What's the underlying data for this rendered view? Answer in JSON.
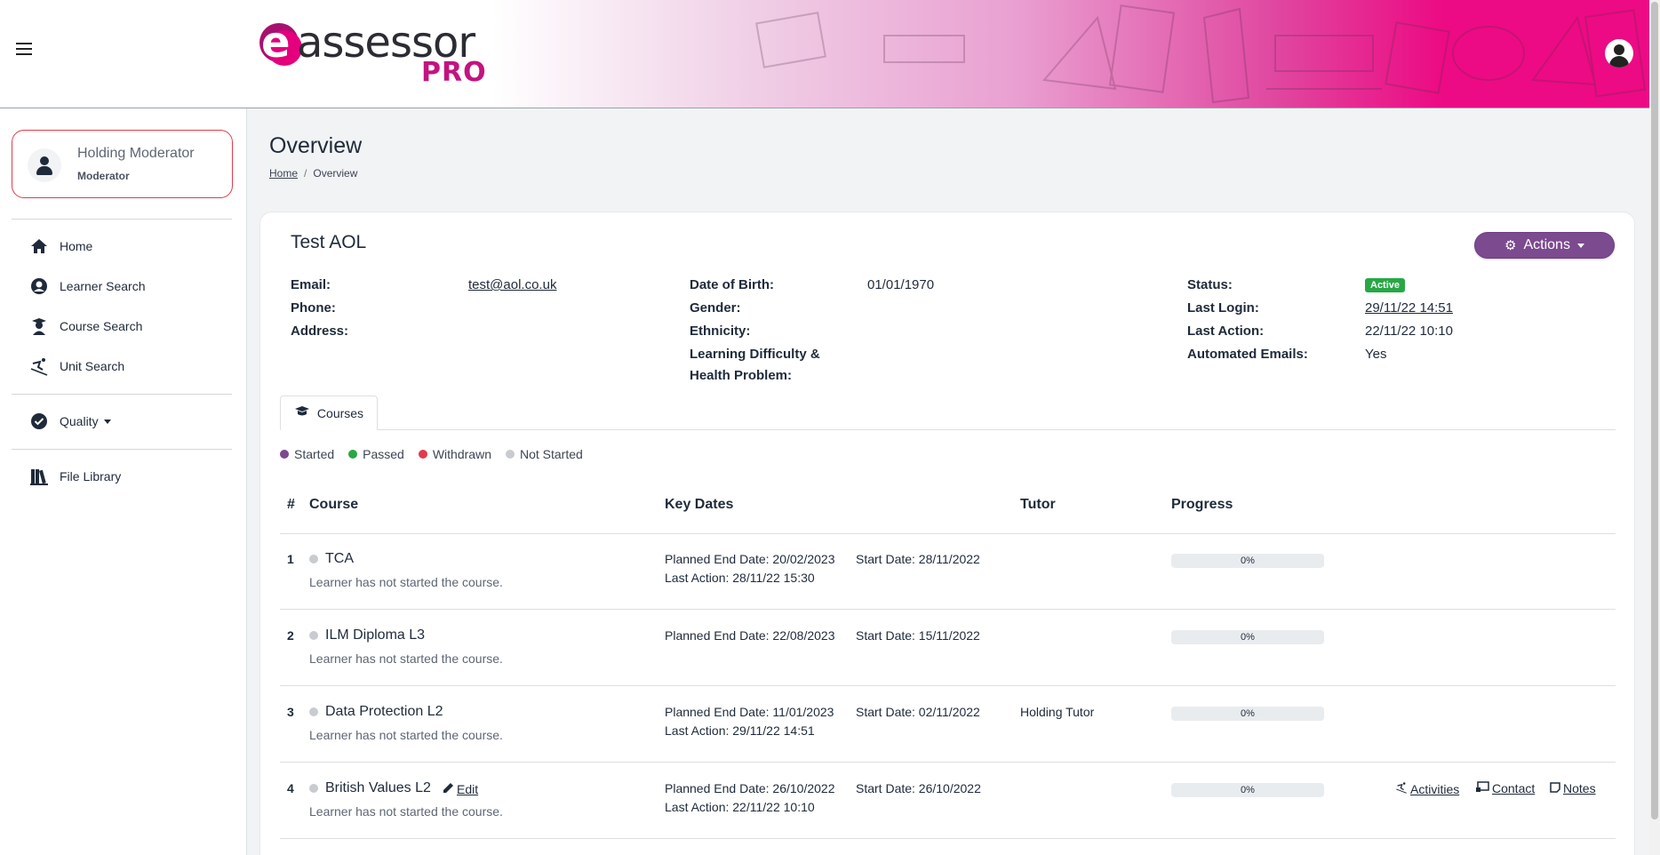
{
  "header": {
    "logo_letter": "e",
    "logo_word": "assessor",
    "logo_pro": "PRO"
  },
  "sidebar": {
    "profile": {
      "name": "Holding Moderator",
      "role": "Moderator"
    },
    "items": [
      {
        "label": "Home",
        "icon": "home-icon"
      },
      {
        "label": "Learner Search",
        "icon": "user-circle-icon"
      },
      {
        "label": "Course Search",
        "icon": "graduate-icon"
      },
      {
        "label": "Unit Search",
        "icon": "skiing-icon"
      },
      {
        "label": "Quality",
        "icon": "check-circle-icon"
      },
      {
        "label": "File Library",
        "icon": "books-icon"
      }
    ]
  },
  "page": {
    "title": "Overview",
    "breadcrumb": {
      "home": "Home",
      "sep": "/",
      "current": "Overview"
    }
  },
  "learner": {
    "name": "Test AOL",
    "actions_label": "Actions",
    "fields": {
      "email_label": "Email:",
      "email_value": "test@aol.co.uk",
      "phone_label": "Phone:",
      "address_label": "Address:",
      "dob_label": "Date of Birth:",
      "dob_value": "01/01/1970",
      "gender_label": "Gender:",
      "ethnicity_label": "Ethnicity:",
      "ldhp_label_1": "Learning Difficulty &",
      "ldhp_label_2": "Health Problem:",
      "status_label": "Status:",
      "status_value": "Active",
      "last_login_label": "Last Login:",
      "last_login_value": "29/11/22 14:51",
      "last_action_label": "Last Action:",
      "last_action_value": "22/11/22 10:10",
      "auto_emails_label": "Automated Emails:",
      "auto_emails_value": "Yes"
    }
  },
  "tabs": {
    "courses": "Courses"
  },
  "legend": [
    {
      "label": "Started",
      "color": "#7c4a8f"
    },
    {
      "label": "Passed",
      "color": "#27a844"
    },
    {
      "label": "Withdrawn",
      "color": "#e23c4a"
    },
    {
      "label": "Not Started",
      "color": "#c8ccd1"
    }
  ],
  "table": {
    "headers": {
      "num": "#",
      "course": "Course",
      "key_dates": "Key Dates",
      "tutor": "Tutor",
      "progress": "Progress"
    },
    "rows": [
      {
        "num": "1",
        "course": "TCA",
        "sub": "Learner has not started the course.",
        "planned": "Planned End Date: 20/02/2023",
        "last_action": "Last Action: 28/11/22 15:30",
        "start": "Start Date: 28/11/2022",
        "tutor": "",
        "progress": 0,
        "progress_label": "0%"
      },
      {
        "num": "2",
        "course": "ILM Diploma L3",
        "sub": "Learner has not started the course.",
        "planned": "Planned End Date: 22/08/2023",
        "last_action": "",
        "start": "Start Date: 15/11/2022",
        "tutor": "",
        "progress": 0,
        "progress_label": "0%"
      },
      {
        "num": "3",
        "course": "Data Protection L2",
        "sub": "Learner has not started the course.",
        "planned": "Planned End Date: 11/01/2023",
        "last_action": "Last Action: 29/11/22 14:51",
        "start": "Start Date: 02/11/2022",
        "tutor": "Holding Tutor",
        "progress": 0,
        "progress_label": "0%"
      },
      {
        "num": "4",
        "course": "British Values L2",
        "sub": "Learner has not started the course.",
        "planned": "Planned End Date: 26/10/2022",
        "last_action": "Last Action: 22/11/22 10:10",
        "start": "Start Date: 26/10/2022",
        "tutor": "",
        "progress": 0,
        "progress_label": "0%",
        "edit": "Edit",
        "activities": "Activities",
        "contact": "Contact",
        "notes": "Notes"
      }
    ]
  },
  "colors": {
    "accent": "#7c4a8f",
    "brand_pink": "#ec0b84",
    "active_badge": "#27a844",
    "profile_border": "#e23c4a"
  }
}
